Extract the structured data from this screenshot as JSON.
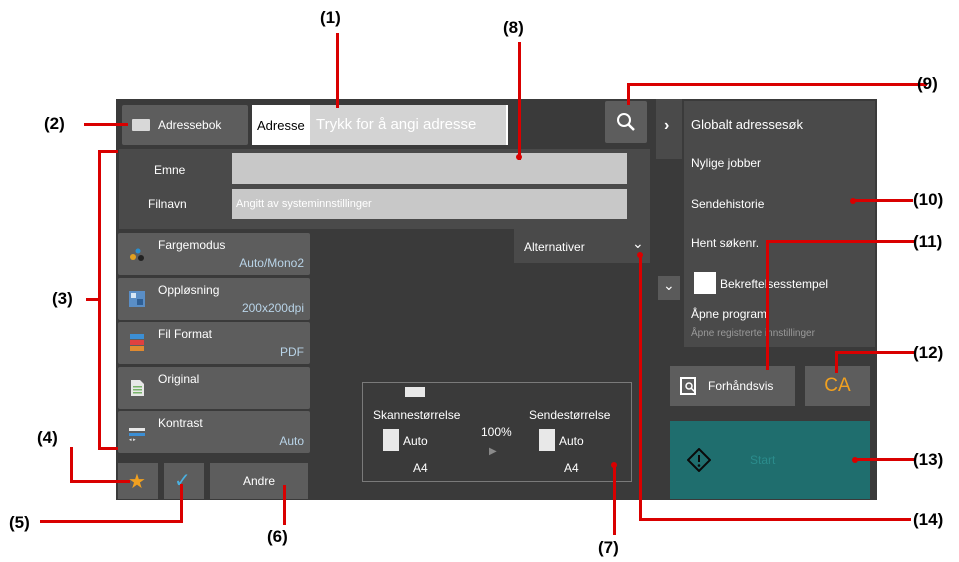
{
  "callouts": {
    "c1": "(1)",
    "c2": "(2)",
    "c3": "(3)",
    "c4": "(4)",
    "c5": "(5)",
    "c6": "(6)",
    "c7": "(7)",
    "c8": "(8)",
    "c9": "(9)",
    "c10": "(10)",
    "c11": "(11)",
    "c12": "(12)",
    "c13": "(13)",
    "c14": "(14)"
  },
  "header": {
    "addressbook_label": "Adressebok",
    "address_tag": "Adresse",
    "address_placeholder": "Trykk for å angi adresse"
  },
  "fields": {
    "subject_label": "Emne",
    "subject_value": "",
    "filename_label": "Filnavn",
    "filename_placeholder": "Angitt av systeminnstillinger"
  },
  "options_label": "Alternativer",
  "modes": [
    {
      "label": "Fargemodus",
      "value": "Auto/Mono2",
      "icon": "color-mode-icon"
    },
    {
      "label": "Oppløsning",
      "value": "200x200dpi",
      "icon": "resolution-icon"
    },
    {
      "label": "Fil Format",
      "value": "PDF",
      "icon": "file-format-icon"
    },
    {
      "label": "Original",
      "value": "",
      "icon": "original-icon"
    },
    {
      "label": "Kontrast",
      "value": "Auto",
      "icon": "contrast-icon"
    }
  ],
  "bottom": {
    "other_label": "Andre"
  },
  "preview_box": {
    "scan_size_label": "Skannestørrelse",
    "send_size_label": "Sendestørrelse",
    "scan_auto": "Auto",
    "send_auto": "Auto",
    "ratio": "100%",
    "scan_paper": "A4",
    "send_paper": "A4"
  },
  "right_panel": {
    "items": [
      "Globalt adressesøk",
      "Nylige jobber",
      "Sendehistorie",
      "Hent søkenr."
    ],
    "checkbox_label": "Bekreftelsesstempel",
    "program_title": "Åpne program",
    "program_sub": "Åpne registrerte innstillinger"
  },
  "actions": {
    "preview_label": "Forhåndsvis",
    "ca_label": "CA",
    "start_label": "Start"
  },
  "colors": {
    "accent_blue": "#2f9fd8",
    "start_teal": "#1f6e6e",
    "callout_red": "#d90000"
  }
}
